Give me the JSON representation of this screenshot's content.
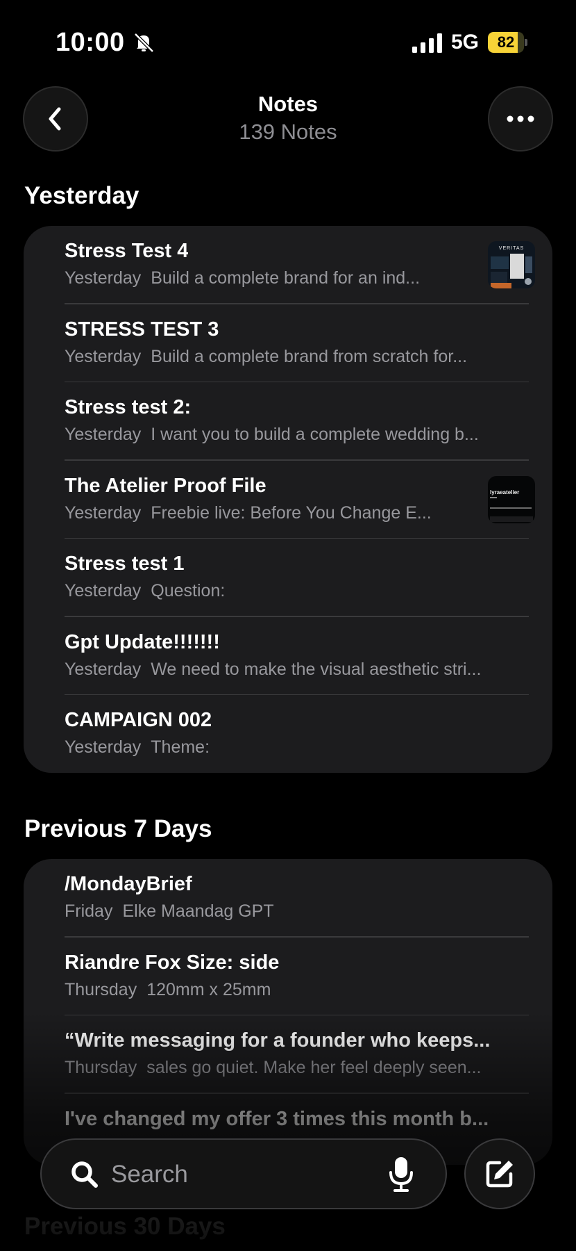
{
  "status_bar": {
    "time": "10:00",
    "network": "5G",
    "battery": "82",
    "battery_level": 0.82,
    "accent_color": "#f7d337"
  },
  "header": {
    "title": "Notes",
    "subtitle": "139 Notes",
    "back_icon": "chevron-left-icon",
    "more_icon": "ellipsis-icon"
  },
  "sections": [
    {
      "title": "Yesterday",
      "notes": [
        {
          "title": "Stress Test 4",
          "date": "Yesterday",
          "preview": "Build a complete brand for an ind...",
          "thumbnail": true
        },
        {
          "title": "STRESS TEST 3",
          "date": "Yesterday",
          "preview": "Build a complete brand from scratch for...",
          "thumbnail": false
        },
        {
          "title": "Stress test 2:",
          "date": "Yesterday",
          "preview": "I want you to build a complete wedding b...",
          "thumbnail": false
        },
        {
          "title": "The Atelier Proof File",
          "date": "Yesterday",
          "preview": "Freebie live: Before You Change E...",
          "thumbnail": true
        },
        {
          "title": "Stress test 1",
          "date": "Yesterday",
          "preview": "Question:",
          "thumbnail": false
        },
        {
          "title": "Gpt Update!!!!!!!",
          "date": "Yesterday",
          "preview": "We need to make the visual aesthetic stri...",
          "thumbnail": false
        },
        {
          "title": "CAMPAIGN 002",
          "date": "Yesterday",
          "preview": "Theme:",
          "thumbnail": false
        }
      ]
    },
    {
      "title": "Previous 7 Days",
      "notes": [
        {
          "title": "/MondayBrief",
          "date": "Friday",
          "preview": "Elke Maandag GPT",
          "thumbnail": false
        },
        {
          "title": "Riandre Fox Size: side",
          "date": "Thursday",
          "preview": "120mm x 25mm",
          "thumbnail": false
        },
        {
          "title": "“Write messaging for a founder who keeps...",
          "date": "Thursday",
          "preview": "sales go quiet. Make her feel deeply seen...",
          "thumbnail": false
        },
        {
          "title": "I've changed my offer 3 times this month b...",
          "date": "",
          "preview": "",
          "thumbnail": false
        }
      ]
    },
    {
      "title": "Previous 30 Days",
      "notes": []
    }
  ],
  "thumbnails": {
    "stress_test_4_text": "VERITAS",
    "atelier_text": "lyraeatelier"
  },
  "search": {
    "placeholder": "Search",
    "search_icon": "search-icon",
    "mic_icon": "microphone-icon"
  },
  "compose": {
    "icon": "compose-icon"
  }
}
